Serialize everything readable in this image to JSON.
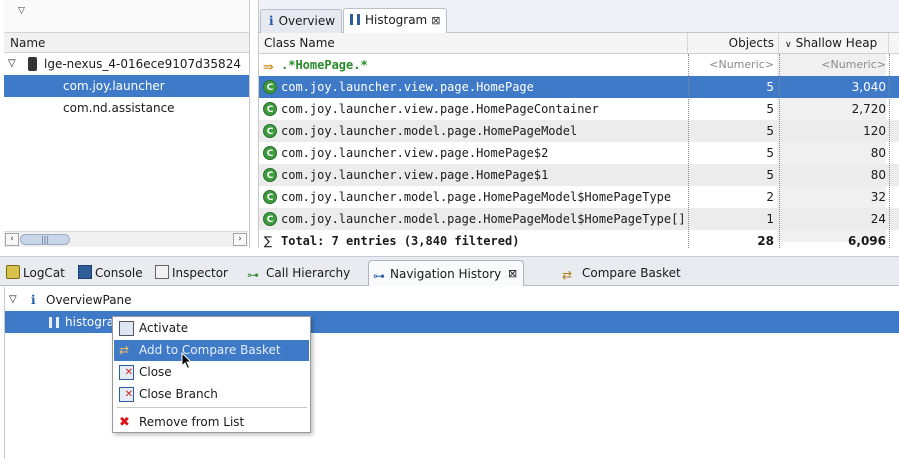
{
  "left": {
    "column_header": "Name",
    "device": "lge-nexus_4-016ece9107d35824",
    "processes": [
      "com.joy.launcher",
      "com.nd.assistance"
    ]
  },
  "editor": {
    "tabs": [
      "Overview",
      "Histogram"
    ],
    "columns": {
      "class_name": "Class Name",
      "objects": "Objects",
      "shallow_heap": "Shallow Heap"
    },
    "filter": {
      "pattern": ".*HomePage.*",
      "objects": "<Numeric>",
      "shallow": "<Numeric>"
    },
    "rows": [
      {
        "name": "com.joy.launcher.view.page.HomePage",
        "objects": "5",
        "heap": "3,040"
      },
      {
        "name": "com.joy.launcher.view.page.HomePageContainer",
        "objects": "5",
        "heap": "2,720"
      },
      {
        "name": "com.joy.launcher.model.page.HomePageModel",
        "objects": "5",
        "heap": "120"
      },
      {
        "name": "com.joy.launcher.view.page.HomePage$2",
        "objects": "5",
        "heap": "80"
      },
      {
        "name": "com.joy.launcher.view.page.HomePage$1",
        "objects": "5",
        "heap": "80"
      },
      {
        "name": "com.joy.launcher.model.page.HomePageModel$HomePageType",
        "objects": "2",
        "heap": "32"
      },
      {
        "name": "com.joy.launcher.model.page.HomePageModel$HomePageType[]",
        "objects": "1",
        "heap": "24"
      }
    ],
    "total": {
      "label": "Total: 7 entries (3,840 filtered)",
      "objects": "28",
      "heap": "6,096"
    }
  },
  "view_tabs": [
    "LogCat",
    "Console",
    "Inspector",
    "Call Hierarchy",
    "Navigation History",
    "Compare Basket"
  ],
  "nav": {
    "root": "OverviewPane",
    "child": "histogram"
  },
  "context_menu": [
    "Activate",
    "Add to Compare Basket",
    "Close",
    "Close Branch",
    "Remove from List"
  ],
  "colors": {
    "selection": "#3e7ac8",
    "class_icon": "#3e9b3e",
    "filter_text": "#2a8a2a"
  }
}
